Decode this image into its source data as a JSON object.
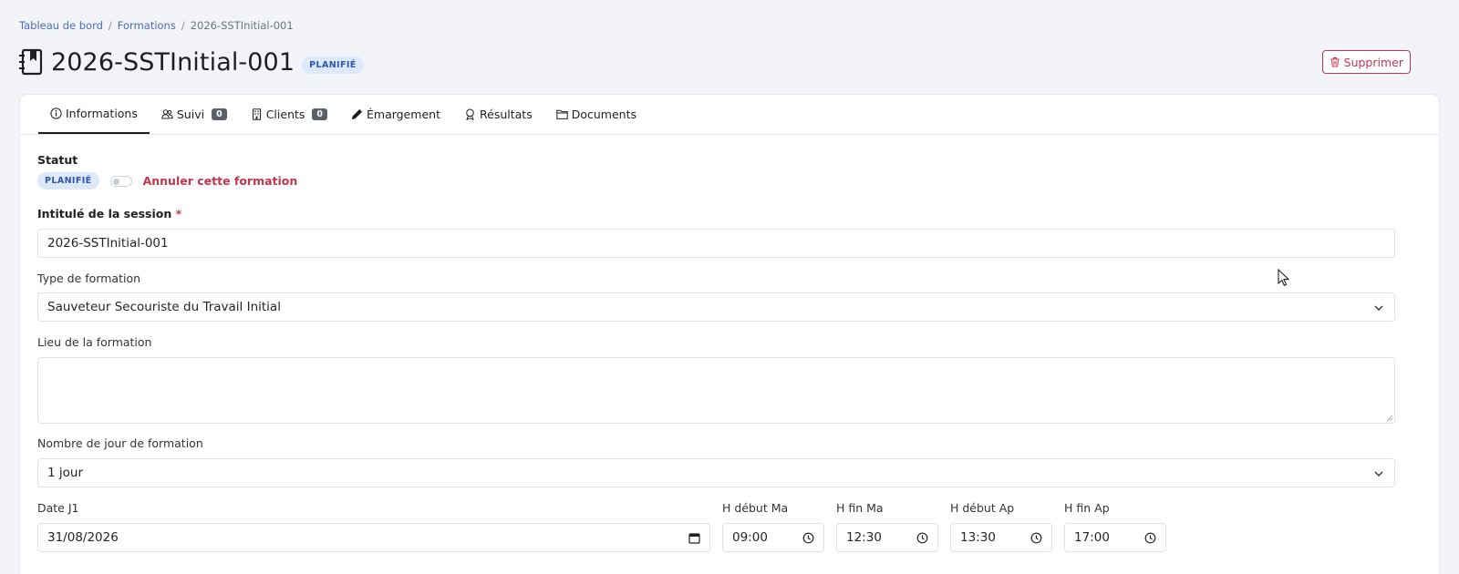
{
  "breadcrumb": {
    "items": [
      "Tableau de bord",
      "Formations"
    ],
    "separator": "/",
    "current": "2026-SSTInitial-001"
  },
  "header": {
    "title": "2026-SSTInitial-001",
    "status_badge": "PLANIFIÉ",
    "delete_label": "Supprimer"
  },
  "tabs": [
    {
      "label": "Informations",
      "icon": "info-icon",
      "active": true
    },
    {
      "label": "Suivi",
      "icon": "users-icon",
      "count": "0"
    },
    {
      "label": "Clients",
      "icon": "building-icon",
      "count": "0"
    },
    {
      "label": "Émargement",
      "icon": "pen-icon"
    },
    {
      "label": "Résultats",
      "icon": "award-icon"
    },
    {
      "label": "Documents",
      "icon": "folder-icon"
    }
  ],
  "form": {
    "statut_label": "Statut",
    "statut_badge": "PLANIFIÉ",
    "cancel_label": "Annuler cette formation",
    "intitule_label": "Intitulé de la session",
    "required_mark": "*",
    "intitule_value": "2026-SSTInitial-001",
    "type_label": "Type de formation",
    "type_value": "Sauveteur Secouriste du Travail Initial",
    "lieu_label": "Lieu de la formation",
    "lieu_value": "",
    "nb_jours_label": "Nombre de jour de formation",
    "nb_jours_value": "1 jour",
    "date_label": "Date J1",
    "date_value": "31/08/2026",
    "h_debut_ma_label": "H début Ma",
    "h_debut_ma_value": "09:00",
    "h_fin_ma_label": "H fin Ma",
    "h_fin_ma_value": "12:30",
    "h_debut_ap_label": "H début Ap",
    "h_debut_ap_value": "13:30",
    "h_fin_ap_label": "H fin Ap",
    "h_fin_ap_value": "17:00"
  },
  "colors": {
    "accent_danger": "#c0364f",
    "badge_bg": "#dde8fb",
    "badge_text": "#2d56b0",
    "link": "#4b6cb7"
  }
}
